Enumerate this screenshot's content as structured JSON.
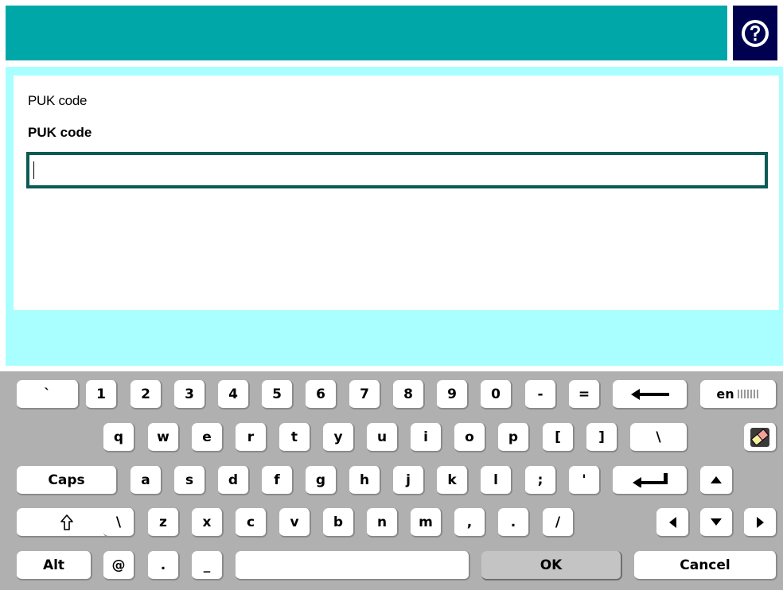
{
  "dialog": {
    "caption": "PUK code",
    "field_label": "PUK code",
    "input_value": ""
  },
  "keyboard": {
    "row1": [
      "`",
      "1",
      "2",
      "3",
      "4",
      "5",
      "6",
      "7",
      "8",
      "9",
      "0",
      "-",
      "="
    ],
    "row2": [
      "q",
      "w",
      "e",
      "r",
      "t",
      "y",
      "u",
      "i",
      "o",
      "p",
      "[",
      "]",
      "\\"
    ],
    "row3": [
      "a",
      "s",
      "d",
      "f",
      "g",
      "h",
      "j",
      "k",
      "l",
      ";",
      "'"
    ],
    "row4": [
      "\\",
      "z",
      "x",
      "c",
      "v",
      "b",
      "n",
      "m",
      ",",
      ".",
      "/"
    ],
    "caps_label": "Caps",
    "alt_label": "Alt",
    "at_label": "@",
    "dot_label": ".",
    "underscore_label": "_",
    "ok_label": "OK",
    "cancel_label": "Cancel",
    "language_label": "en"
  },
  "icons": {
    "help": "help-icon",
    "backspace": "backspace-arrow-icon",
    "enter": "enter-arrow-icon",
    "clear": "eraser-icon",
    "shift": "shift-icon",
    "up": "arrow-up-icon",
    "down": "arrow-down-icon",
    "left": "arrow-left-icon",
    "right": "arrow-right-icon"
  },
  "colors": {
    "header": "#00a7a8",
    "help_button": "#000050",
    "content_frame": "#a9ffff",
    "input_border": "#0c5a55",
    "keyboard_bg": "#b0b0b0"
  }
}
